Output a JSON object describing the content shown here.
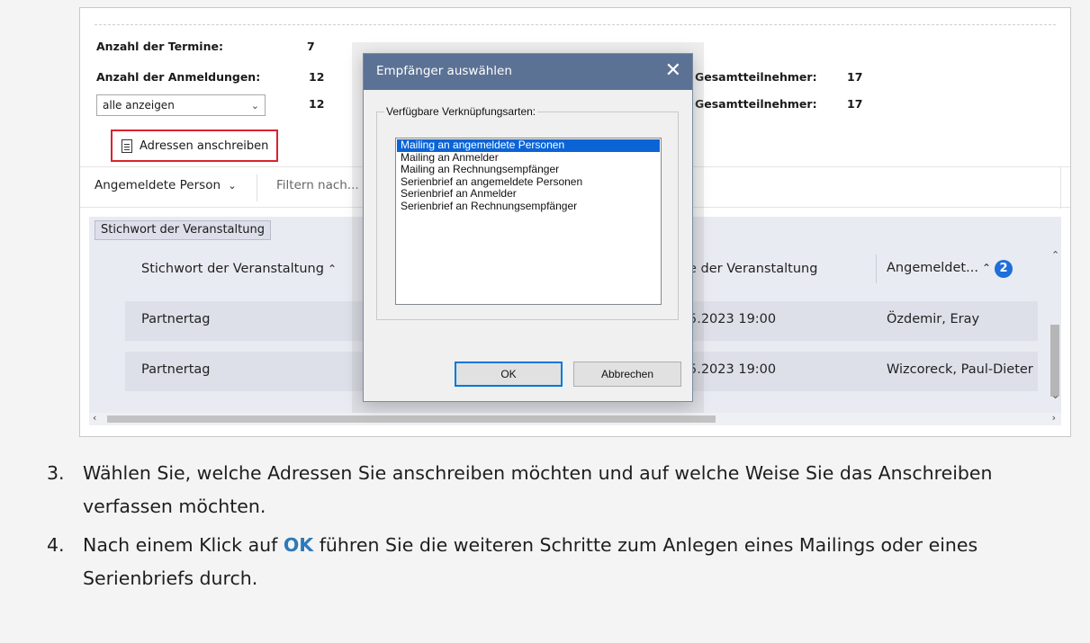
{
  "stats": {
    "termine_label": "Anzahl der Termine:",
    "termine_value": "7",
    "anmeldungen_label": "Anzahl der Anmeldungen:",
    "anmeldungen_value": "12",
    "filtered_value": "12",
    "gesamt_label": "Gesamtteilnehmer:",
    "gesamt_value": "17",
    "gesamt2_label": "Gesamtteilnehmer:",
    "gesamt2_value": "17"
  },
  "filter_select": {
    "value": "alle anzeigen"
  },
  "address_button": {
    "label": "Adressen anschreiben"
  },
  "toolbar": {
    "person_dropdown": "Angemeldete Person",
    "filter_placeholder": "Filtern nach..."
  },
  "grid": {
    "group_chip": "Stichwort der Veranstaltung",
    "columns": [
      {
        "label": "Stichwort der Veranstaltung"
      },
      {
        "label": "e der Veranstaltung"
      },
      {
        "label": "Angemeldet...",
        "sort_badge": "2"
      }
    ],
    "rows": [
      {
        "stichwort": "Partnertag",
        "datum": "5.2023 19:00",
        "person": "Özdemir, Eray"
      },
      {
        "stichwort": "Partnertag",
        "datum": "5.2023 19:00",
        "person": "Wizcoreck, Paul-Dieter"
      }
    ]
  },
  "dialog": {
    "title": "Empfänger auswählen",
    "group_label": "Verfügbare Verknüpfungsarten:",
    "options": [
      "Mailing an angemeldete Personen",
      "Mailing an Anmelder",
      "Mailing an Rechnungsempfänger",
      "Serienbrief an angemeldete Personen",
      "Serienbrief an Anmelder",
      "Serienbrief an Rechnungsempfänger"
    ],
    "selected_index": 0,
    "ok_label": "OK",
    "cancel_label": "Abbrechen"
  },
  "steps": [
    {
      "number": "3.",
      "text": "Wählen Sie, welche Adressen Sie anschreiben möchten und auf welche Weise Sie das Anschreiben verfassen möchten."
    },
    {
      "number": "4.",
      "before": "Nach einem Klick auf",
      "ok": "OK",
      "after": "führen Sie die weiteren Schritte zum Anlegen eines Mailings oder eines Serienbriefs durch."
    }
  ],
  "colors": {
    "dialog_titlebar": "#5b7295",
    "selection": "#0a64d6",
    "highlight_border": "#d9232e",
    "ok_text": "#2e79b9",
    "badge": "#1e6fd9"
  }
}
